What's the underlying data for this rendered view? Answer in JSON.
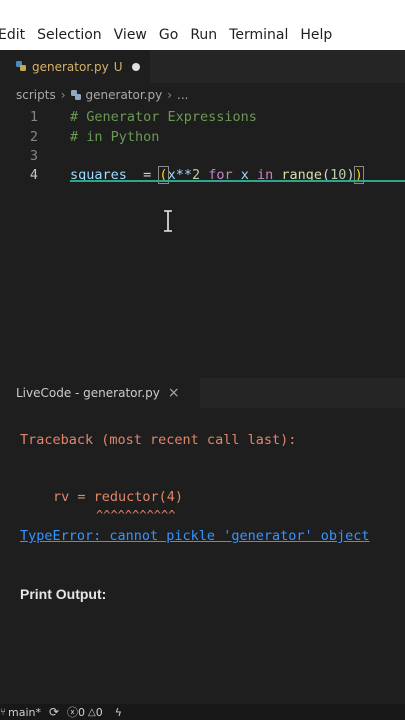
{
  "menu": [
    "Edit",
    "Selection",
    "View",
    "Go",
    "Run",
    "Terminal",
    "Help"
  ],
  "tab": {
    "filename": "generator.py",
    "status": "U"
  },
  "breadcrumb": {
    "folder": "scripts",
    "file": "generator.py",
    "more": "..."
  },
  "editor": {
    "lines": [
      {
        "num": "1",
        "text": "# Generator Expressions"
      },
      {
        "num": "2",
        "text": "# in Python"
      },
      {
        "num": "3",
        "text": ""
      },
      {
        "num": "4",
        "text": "squares  = (x**2 for x in range(10))"
      }
    ],
    "tokens": {
      "var": "squares",
      "eq": "  = ",
      "open": "(",
      "x1": "x**",
      "two": "2",
      "for": " for ",
      "x2": "x",
      "in": " in ",
      "range": "range",
      "ropen": "(",
      "ten": "10",
      "rclose": ")",
      "close": ")"
    }
  },
  "panel": {
    "tab_label": "LiveCode - generator.py",
    "close": "×"
  },
  "output": {
    "traceback": "Traceback (most recent call last):",
    "rv_line": "rv = reductor(4)",
    "caret_line": "^^^^^^^^^^^",
    "error": "TypeError: cannot pickle 'generator' object",
    "print_output": "Print Output:"
  },
  "status": {
    "branch": "main*",
    "errors": "0",
    "warnings": "0"
  },
  "colors": {
    "accent": "#2aa889",
    "error_text": "#e0866a",
    "link": "#3794ff"
  }
}
